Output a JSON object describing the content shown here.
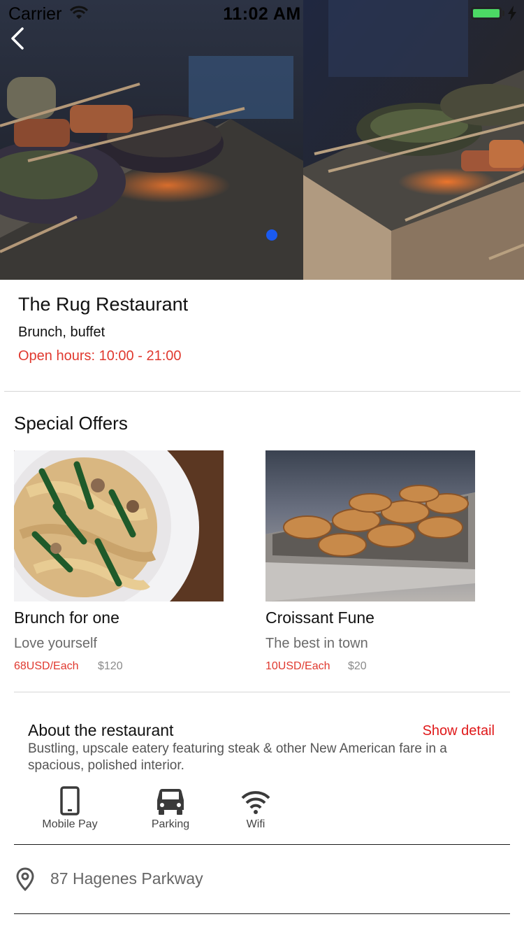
{
  "status_bar": {
    "carrier": "Carrier",
    "time": "11:02 AM"
  },
  "hero": {
    "images": [
      "grilled-skewers-photo",
      "grilled-skewers-photo-2"
    ],
    "active_index": 0,
    "indicator_color": "#1a5af0"
  },
  "restaurant": {
    "name": "The Rug Restaurant",
    "category": "Brunch, buffet",
    "hours": "Open hours: 10:00 - 21:00"
  },
  "offers": {
    "section_title": "Special Offers",
    "items": [
      {
        "name": "Brunch for one",
        "subtitle": "Love yourself",
        "price": "68USD/Each",
        "old_price": "$120",
        "image": "pasta-dish-photo"
      },
      {
        "name": "Croissant Fune",
        "subtitle": "The best in town",
        "price": "10USD/Each",
        "old_price": "$20",
        "image": "croissant-tray-photo"
      }
    ]
  },
  "about": {
    "title": "About the restaurant",
    "show_detail": "Show detail",
    "description": "Bustling, upscale eatery featuring steak & other New American fare in a spacious, polished interior."
  },
  "amenities": [
    {
      "label": "Mobile Pay",
      "icon": "phone-icon"
    },
    {
      "label": "Parking",
      "icon": "car-icon"
    },
    {
      "label": "Wifi",
      "icon": "wifi-icon"
    }
  ],
  "address": {
    "text": "87 Hagenes Parkway",
    "icon": "location-pin-icon"
  },
  "colors": {
    "accent_red": "#e0392f",
    "link_red": "#e0191a",
    "text_gray": "#666666"
  }
}
